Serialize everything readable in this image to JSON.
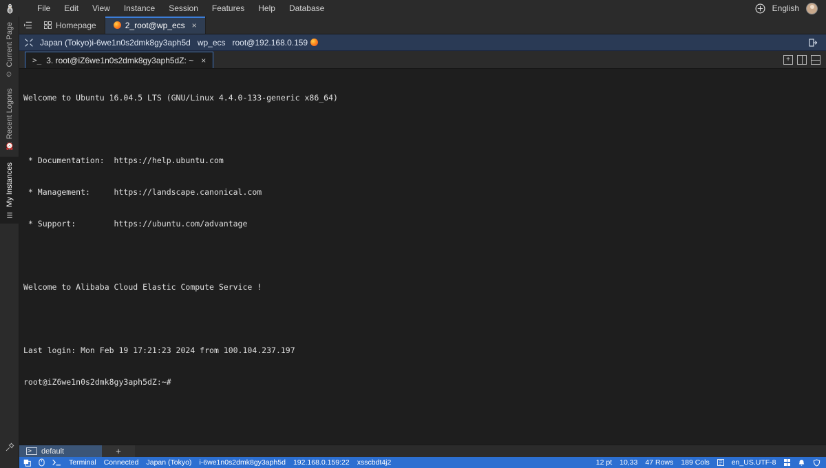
{
  "app": {
    "logo_icon": "penguin-logo",
    "language": "English",
    "add_icon": "plus-circle-icon",
    "avatar_icon": "user-avatar"
  },
  "menubar": {
    "items": [
      {
        "label": "File",
        "name": "menu-file"
      },
      {
        "label": "Edit",
        "name": "menu-edit"
      },
      {
        "label": "View",
        "name": "menu-view"
      },
      {
        "label": "Instance",
        "name": "menu-instance"
      },
      {
        "label": "Session",
        "name": "menu-session"
      },
      {
        "label": "Features",
        "name": "menu-features"
      },
      {
        "label": "Help",
        "name": "menu-help"
      },
      {
        "label": "Database",
        "name": "menu-database"
      }
    ]
  },
  "rail": {
    "items": [
      {
        "label": "Current Page",
        "icon": "clock-icon",
        "active": false
      },
      {
        "label": "Recent Logons",
        "icon": "history-icon",
        "active": false
      },
      {
        "label": "My Instances",
        "icon": "list-icon",
        "active": true
      }
    ],
    "pin_icon": "pin-icon"
  },
  "tabs": {
    "list_icon": "tab-list-icon",
    "items": [
      {
        "label": "Homepage",
        "icon": "grid-icon",
        "active": false,
        "closable": false
      },
      {
        "label": "2_root@wp_ecs",
        "icon": "session-icon",
        "active": true,
        "closable": true
      }
    ],
    "close_glyph": "×"
  },
  "session_bar": {
    "icon": "fullscreen-icon",
    "region": "Japan (Tokyo)",
    "instance_id": "i-6we1n0s2dmk8gy3aph5d",
    "instance_name": "wp_ecs",
    "user_host": "root@192.168.0.159",
    "status_badge": "connected-badge",
    "exit_icon": "logout-icon"
  },
  "subtabs": {
    "items": [
      {
        "prompt_icon": "terminal-prompt-icon",
        "label": "3. root@iZ6we1n0s2dmk8gy3aph5dZ: ~",
        "active": true
      }
    ],
    "close_glyph": "×",
    "actions": [
      {
        "name": "new-pane-button",
        "icon": "plus-square-icon",
        "glyph": "+"
      },
      {
        "name": "split-vertical-button",
        "icon": "split-vertical-icon",
        "glyph": ""
      },
      {
        "name": "split-horizontal-button",
        "icon": "split-horizontal-icon",
        "glyph": ""
      }
    ]
  },
  "terminal": {
    "lines": [
      "Welcome to Ubuntu 16.04.5 LTS (GNU/Linux 4.4.0-133-generic x86_64)",
      "",
      " * Documentation:  https://help.ubuntu.com",
      " * Management:     https://landscape.canonical.com",
      " * Support:        https://ubuntu.com/advantage",
      "",
      "Welcome to Alibaba Cloud Elastic Compute Service !",
      "",
      "Last login: Mon Feb 19 17:21:23 2024 from 100.104.237.197",
      "root@iZ6we1n0s2dmk8gy3aph5dZ:~#"
    ]
  },
  "workspace_bar": {
    "tab_icon": "terminal-icon",
    "tab_label": "default",
    "add_label": "+"
  },
  "statusbar": {
    "copy_icon": "copy-icon",
    "mouse_icon": "mouse-icon",
    "terminal_icon": "terminal-prompt-icon",
    "type_label": "Terminal",
    "connection_label": "Connected",
    "region_label": "Japan (Tokyo)",
    "instance_id": "i-6we1n0s2dmk8gy3aph5d",
    "address": "192.168.0.159:22",
    "session_id": "xsscbdt4j2",
    "font_size": "12 pt",
    "cursor_pos": "10,33",
    "rows": "47 Rows",
    "cols": "189 Cols",
    "encoding_icon": "encoding-icon",
    "encoding": "en_US.UTF-8",
    "keyboard_icon": "keyboard-icon",
    "bell_icon": "bell-icon",
    "shield_icon": "shield-icon"
  },
  "colors": {
    "accent_blue": "#2c6fd1",
    "tab_active_border": "#3b7dd8",
    "session_bar_bg": "#2a3a55",
    "chrome_bg": "#2b2b2b",
    "terminal_bg": "#1e1e1e",
    "workspace_tab_bg": "#3b5577"
  }
}
